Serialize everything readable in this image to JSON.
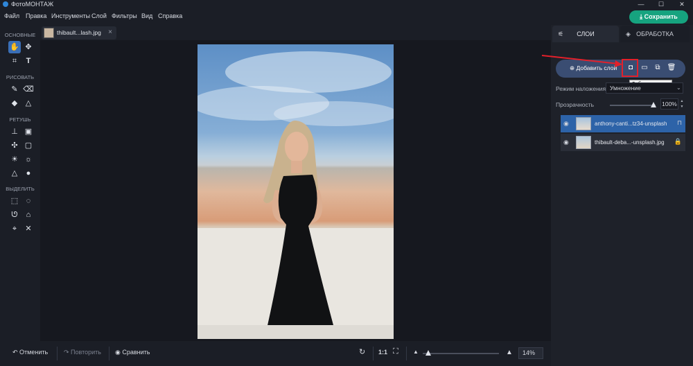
{
  "window": {
    "title": "ФотоМОНТАЖ",
    "minimize": "—",
    "maximize": "☐",
    "close": "✕"
  },
  "menu": [
    "Файл",
    "Правка",
    "Инструменты",
    "Слой",
    "Фильтры",
    "Вид",
    "Справка"
  ],
  "save_button": "Сохранить",
  "toolbar": {
    "groups": [
      "ОСНОВНЫЕ",
      "РИСОВАТЬ",
      "РЕТУШЬ",
      "ВЫДЕЛИТЬ"
    ]
  },
  "document_tab": {
    "name": "thibault...lash.jpg",
    "close": "×"
  },
  "bottom": {
    "undo": "Отменить",
    "redo": "Повторить",
    "compare": "Сравнить",
    "ratio": "1:1",
    "zoom": "14%"
  },
  "right_panel": {
    "tab_layers": "СЛОИ",
    "tab_processing": "ОБРАБОТКА",
    "add_layer": "Добавить слой",
    "tooltip": "Добавить маску",
    "blend_label": "Режим наложения:",
    "blend_value": "Умножение",
    "opacity_label": "Прозрачность",
    "opacity_value": "100%",
    "opacity_level": 1.0,
    "layers": [
      {
        "name": "anthony-canti...tz34-unsplash",
        "selected": true
      },
      {
        "name": "thibault-deba...-unsplash.jpg",
        "selected": false
      }
    ]
  },
  "colors": {
    "accent": "#3a6fb7",
    "save": "#16a37f",
    "highlight": "#e3202a",
    "layer_selected": "#2d63a8"
  }
}
